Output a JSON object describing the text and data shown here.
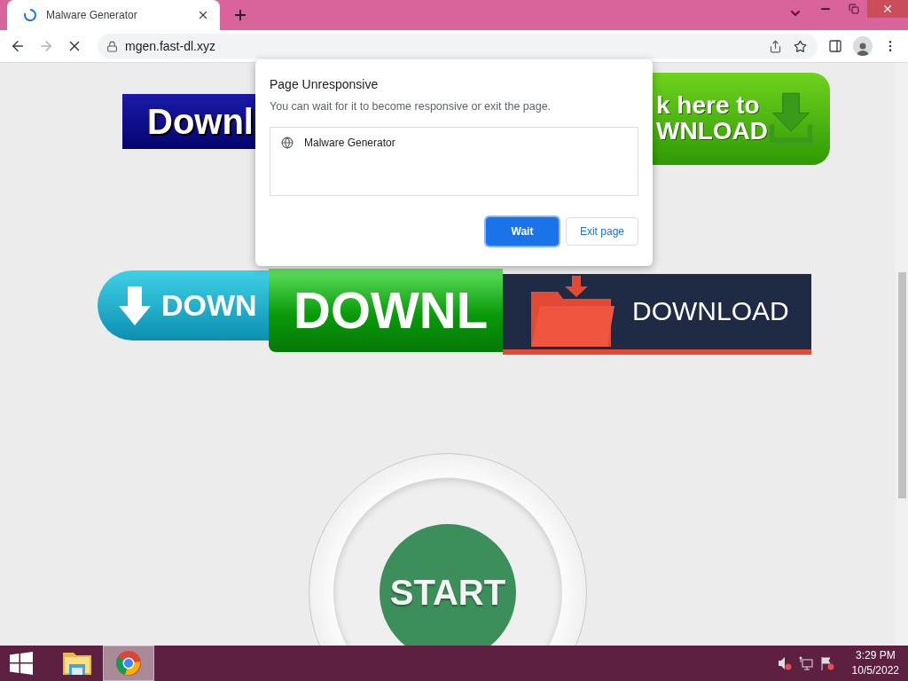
{
  "browser": {
    "tab": {
      "title": "Malware Generator",
      "loading": true
    },
    "address": "mgen.fast-dl.xyz",
    "forward_enabled": false
  },
  "page": {
    "banners": [
      {
        "kind": "navy",
        "lines": [
          "Downl"
        ]
      },
      {
        "kind": "green-arrow",
        "lines": [
          "k here to",
          "WNLOAD"
        ]
      },
      {
        "kind": "cyan",
        "lines": [
          "DOWN"
        ]
      },
      {
        "kind": "green",
        "lines": [
          "DOWNL"
        ]
      },
      {
        "kind": "folder",
        "lines": [
          "DOWNLOAD"
        ]
      }
    ],
    "start_button": "START"
  },
  "dialog": {
    "title": "Page Unresponsive",
    "message": "You can wait for it to become responsive or exit the page.",
    "pages": [
      "Malware Generator"
    ],
    "buttons": [
      {
        "label": "Wait",
        "selected": true
      },
      {
        "label": "Exit page",
        "selected": false
      }
    ]
  },
  "taskbar": {
    "apps": [
      {
        "kind": "explorer",
        "selected": false
      },
      {
        "kind": "chrome",
        "selected": true
      }
    ],
    "time": "3:29 PM",
    "date": "10/5/2022"
  }
}
